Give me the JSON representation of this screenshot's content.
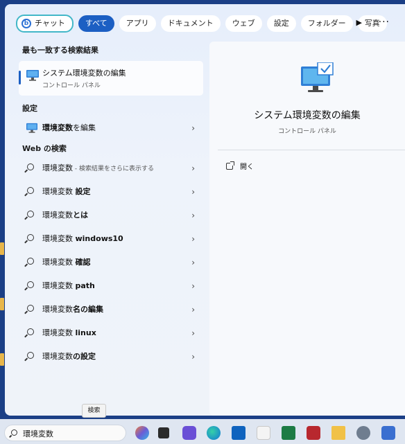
{
  "filters": {
    "chat": "チャット",
    "all": "すべて",
    "apps": "アプリ",
    "documents": "ドキュメント",
    "web": "ウェブ",
    "settings": "設定",
    "folders": "フォルダー",
    "photos": "写真"
  },
  "best_match": {
    "heading": "最も一致する検索結果",
    "title": "システム環境変数の編集",
    "subtitle": "コントロール パネル"
  },
  "settings_section": {
    "heading": "設定",
    "item_prefix": "環境変数",
    "item_suffix": "を編集"
  },
  "web_section": {
    "heading": "Web の検索",
    "items": [
      {
        "term": "環境変数",
        "hint": " - 検索結果をさらに表示する"
      },
      {
        "term": "環境変数 ",
        "bold": "設定"
      },
      {
        "term": "環境変数",
        "bold": "とは"
      },
      {
        "term": "環境変数 ",
        "bold": "windows10"
      },
      {
        "term": "環境変数 ",
        "bold": "確認"
      },
      {
        "term": "環境変数 ",
        "bold": "path"
      },
      {
        "term": "環境変数",
        "bold": "名の編集"
      },
      {
        "term": "環境変数 ",
        "bold": "linux"
      },
      {
        "term": "環境変数",
        "bold": "の設定"
      }
    ]
  },
  "preview": {
    "title": "システム環境変数の編集",
    "subtitle": "コントロール パネル",
    "open_label": "開く"
  },
  "tooltip": "検索",
  "taskbar": {
    "search_value": "環境変数"
  },
  "icons": {
    "chevron": "›",
    "play": "▶",
    "more": "···"
  }
}
